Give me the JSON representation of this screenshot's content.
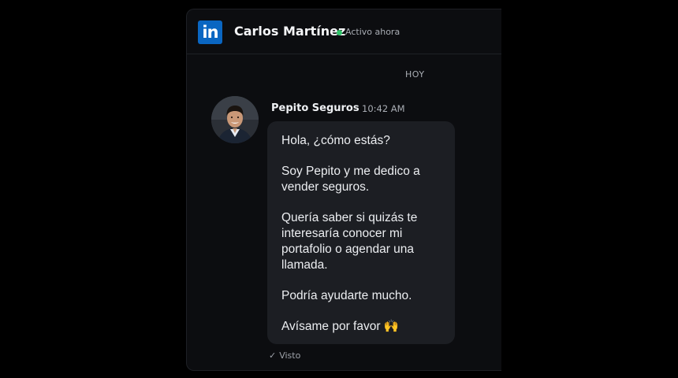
{
  "header": {
    "logo_text": "in",
    "contact_name": "Carlos Martínez",
    "status": "Activo ahora",
    "status_color": "#31c46a",
    "brand_color": "#0a66c2"
  },
  "conversation": {
    "date_label": "HOY",
    "message": {
      "sender": "Pepito Seguros",
      "time": "10:42 AM",
      "paragraphs": [
        "Hola, ¿cómo estás?",
        "Soy Pepito y me dedico a vender seguros.",
        "Quería saber si quizás te interesaría conocer mi portafolio o agendar una llamada.",
        "Podría ayudarte mucho.",
        "Avísame por favor 🙌"
      ],
      "receipt_icon": "check-icon",
      "receipt": "Visto"
    }
  }
}
